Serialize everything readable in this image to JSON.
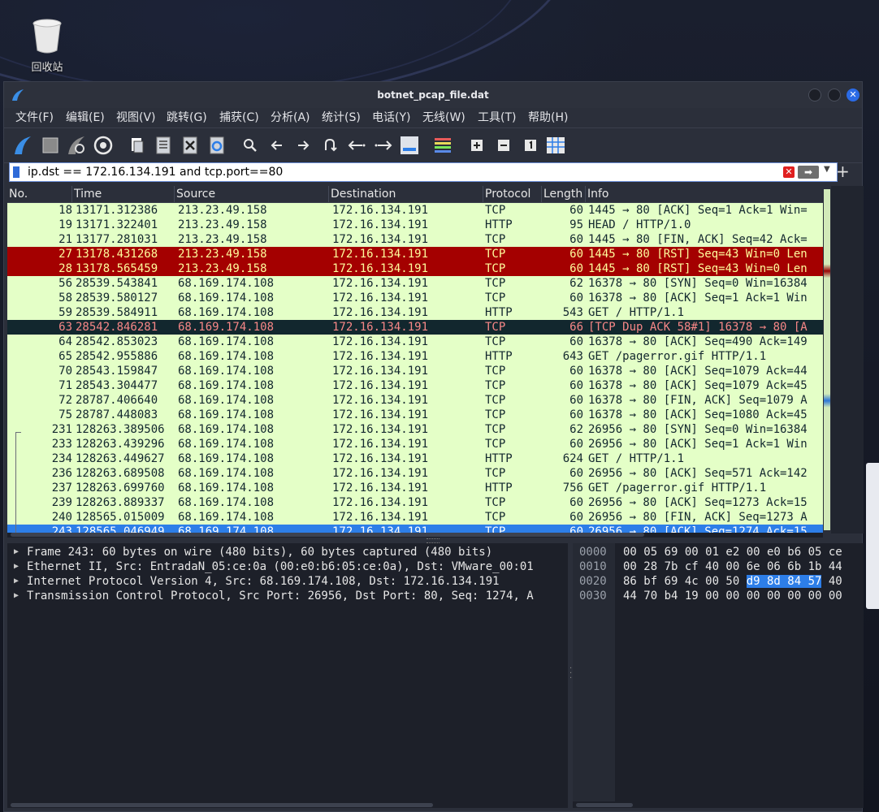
{
  "desktop": {
    "trash_label": "回收站",
    "icon": "trash-icon"
  },
  "window": {
    "title": "botnet_pcap_file.dat",
    "app_icon": "wireshark-fin-icon",
    "close_symbol": "✕"
  },
  "menu": [
    {
      "label": "文件(F)"
    },
    {
      "label": "编辑(E)"
    },
    {
      "label": "视图(V)"
    },
    {
      "label": "跳转(G)"
    },
    {
      "label": "捕获(C)"
    },
    {
      "label": "分析(A)"
    },
    {
      "label": "统计(S)"
    },
    {
      "label": "电话(Y)"
    },
    {
      "label": "无线(W)"
    },
    {
      "label": "工具(T)"
    },
    {
      "label": "帮助(H)"
    }
  ],
  "toolbar_icons": [
    "start-capture-icon",
    "stop-capture-icon",
    "restart-capture-icon",
    "capture-options-icon",
    "open-file-icon",
    "save-file-icon",
    "close-file-icon",
    "reload-file-icon",
    "find-packet-icon",
    "go-back-icon",
    "go-forward-icon",
    "go-to-packet-icon",
    "first-packet-icon",
    "last-packet-icon",
    "auto-scroll-icon",
    "colorize-icon",
    "zoom-in-icon",
    "zoom-out-icon",
    "normal-size-icon",
    "resize-columns-icon"
  ],
  "filter": {
    "value": "ip.dst == 172.16.134.191 and tcp.port==80",
    "apply_symbol": "➡",
    "clear_symbol": "✕",
    "add_symbol": "+"
  },
  "columns": [
    "No.",
    "Time",
    "Source",
    "Destination",
    "Protocol",
    "Length",
    "Info"
  ],
  "packets": [
    {
      "no": "18",
      "time": "13171.312386",
      "src": "213.23.49.158",
      "dst": "172.16.134.191",
      "proto": "TCP",
      "len": "60",
      "info": "1445 → 80 [ACK] Seq=1 Ack=1 Win=",
      "rule": "normal"
    },
    {
      "no": "19",
      "time": "13171.322401",
      "src": "213.23.49.158",
      "dst": "172.16.134.191",
      "proto": "HTTP",
      "len": "95",
      "info": "HEAD / HTTP/1.0",
      "rule": "normal"
    },
    {
      "no": "21",
      "time": "13177.281031",
      "src": "213.23.49.158",
      "dst": "172.16.134.191",
      "proto": "TCP",
      "len": "60",
      "info": "1445 → 80 [FIN, ACK] Seq=42 Ack=",
      "rule": "normal"
    },
    {
      "no": "27",
      "time": "13178.431268",
      "src": "213.23.49.158",
      "dst": "172.16.134.191",
      "proto": "TCP",
      "len": "60",
      "info": "1445 → 80 [RST] Seq=43 Win=0 Len",
      "rule": "rst"
    },
    {
      "no": "28",
      "time": "13178.565459",
      "src": "213.23.49.158",
      "dst": "172.16.134.191",
      "proto": "TCP",
      "len": "60",
      "info": "1445 → 80 [RST] Seq=43 Win=0 Len",
      "rule": "rst"
    },
    {
      "no": "56",
      "time": "28539.543841",
      "src": "68.169.174.108",
      "dst": "172.16.134.191",
      "proto": "TCP",
      "len": "62",
      "info": "16378 → 80 [SYN] Seq=0 Win=16384",
      "rule": "normal"
    },
    {
      "no": "58",
      "time": "28539.580127",
      "src": "68.169.174.108",
      "dst": "172.16.134.191",
      "proto": "TCP",
      "len": "60",
      "info": "16378 → 80 [ACK] Seq=1 Ack=1 Win",
      "rule": "normal"
    },
    {
      "no": "59",
      "time": "28539.584911",
      "src": "68.169.174.108",
      "dst": "172.16.134.191",
      "proto": "HTTP",
      "len": "543",
      "info": "GET / HTTP/1.1",
      "rule": "normal"
    },
    {
      "no": "63",
      "time": "28542.846281",
      "src": "68.169.174.108",
      "dst": "172.16.134.191",
      "proto": "TCP",
      "len": "66",
      "info": "[TCP Dup ACK 58#1] 16378 → 80 [A",
      "rule": "bad"
    },
    {
      "no": "64",
      "time": "28542.853023",
      "src": "68.169.174.108",
      "dst": "172.16.134.191",
      "proto": "TCP",
      "len": "60",
      "info": "16378 → 80 [ACK] Seq=490 Ack=149",
      "rule": "normal"
    },
    {
      "no": "65",
      "time": "28542.955886",
      "src": "68.169.174.108",
      "dst": "172.16.134.191",
      "proto": "HTTP",
      "len": "643",
      "info": "GET /pagerror.gif HTTP/1.1",
      "rule": "normal"
    },
    {
      "no": "70",
      "time": "28543.159847",
      "src": "68.169.174.108",
      "dst": "172.16.134.191",
      "proto": "TCP",
      "len": "60",
      "info": "16378 → 80 [ACK] Seq=1079 Ack=44",
      "rule": "normal"
    },
    {
      "no": "71",
      "time": "28543.304477",
      "src": "68.169.174.108",
      "dst": "172.16.134.191",
      "proto": "TCP",
      "len": "60",
      "info": "16378 → 80 [ACK] Seq=1079 Ack=45",
      "rule": "normal"
    },
    {
      "no": "72",
      "time": "28787.406640",
      "src": "68.169.174.108",
      "dst": "172.16.134.191",
      "proto": "TCP",
      "len": "60",
      "info": "16378 → 80 [FIN, ACK] Seq=1079 A",
      "rule": "normal"
    },
    {
      "no": "75",
      "time": "28787.448083",
      "src": "68.169.174.108",
      "dst": "172.16.134.191",
      "proto": "TCP",
      "len": "60",
      "info": "16378 → 80 [ACK] Seq=1080 Ack=45",
      "rule": "normal"
    },
    {
      "no": "231",
      "time": "128263.389506",
      "src": "68.169.174.108",
      "dst": "172.16.134.191",
      "proto": "TCP",
      "len": "62",
      "info": "26956 → 80 [SYN] Seq=0 Win=16384",
      "rule": "normal"
    },
    {
      "no": "233",
      "time": "128263.439296",
      "src": "68.169.174.108",
      "dst": "172.16.134.191",
      "proto": "TCP",
      "len": "60",
      "info": "26956 → 80 [ACK] Seq=1 Ack=1 Win",
      "rule": "normal"
    },
    {
      "no": "234",
      "time": "128263.449627",
      "src": "68.169.174.108",
      "dst": "172.16.134.191",
      "proto": "HTTP",
      "len": "624",
      "info": "GET / HTTP/1.1",
      "rule": "normal"
    },
    {
      "no": "236",
      "time": "128263.689508",
      "src": "68.169.174.108",
      "dst": "172.16.134.191",
      "proto": "TCP",
      "len": "60",
      "info": "26956 → 80 [ACK] Seq=571 Ack=142",
      "rule": "normal"
    },
    {
      "no": "237",
      "time": "128263.699760",
      "src": "68.169.174.108",
      "dst": "172.16.134.191",
      "proto": "HTTP",
      "len": "756",
      "info": "GET /pagerror.gif HTTP/1.1",
      "rule": "normal"
    },
    {
      "no": "239",
      "time": "128263.889337",
      "src": "68.169.174.108",
      "dst": "172.16.134.191",
      "proto": "TCP",
      "len": "60",
      "info": "26956 → 80 [ACK] Seq=1273 Ack=15",
      "rule": "normal"
    },
    {
      "no": "240",
      "time": "128565.015009",
      "src": "68.169.174.108",
      "dst": "172.16.134.191",
      "proto": "TCP",
      "len": "60",
      "info": "26956 → 80 [FIN, ACK] Seq=1273 A",
      "rule": "normal"
    },
    {
      "no": "243",
      "time": "128565.046949",
      "src": "68.169.174.108",
      "dst": "172.16.134.191",
      "proto": "TCP",
      "len": "60",
      "info": "26956 → 80 [ACK] Seq=1274 Ack=15",
      "rule": "selected"
    }
  ],
  "details": [
    {
      "text": "Frame 243: 60 bytes on wire (480 bits), 60 bytes captured (480 bits)"
    },
    {
      "text": "Ethernet II, Src: EntradaN_05:ce:0a (00:e0:b6:05:ce:0a), Dst: VMware_00:01"
    },
    {
      "text": "Internet Protocol Version 4, Src: 68.169.174.108, Dst: 172.16.134.191"
    },
    {
      "text": "Transmission Control Protocol, Src Port: 26956, Dst Port: 80, Seq: 1274, A"
    }
  ],
  "bytes": [
    {
      "offset": "0000",
      "pre": "00 05 69 00 01 e2 00 e0  b6 05 ce",
      "hl": "",
      "post": ""
    },
    {
      "offset": "0010",
      "pre": "00 28 7b cf 40 00 6e 06  6b 1b 44",
      "hl": "",
      "post": ""
    },
    {
      "offset": "0020",
      "pre": "86 bf 69 4c 00 50 ",
      "hl": "d9 8d  84 57",
      "post": " 40"
    },
    {
      "offset": "0030",
      "pre": "44 70 b4 19 00 00 00 00  00 00 00",
      "hl": "",
      "post": ""
    }
  ],
  "colors": {
    "normal_bg": "#e4ffc7",
    "rst_bg": "#a40000",
    "bad_bg": "#12272e",
    "selected_bg": "#2d7ee8",
    "accent": "#2b6be6"
  }
}
